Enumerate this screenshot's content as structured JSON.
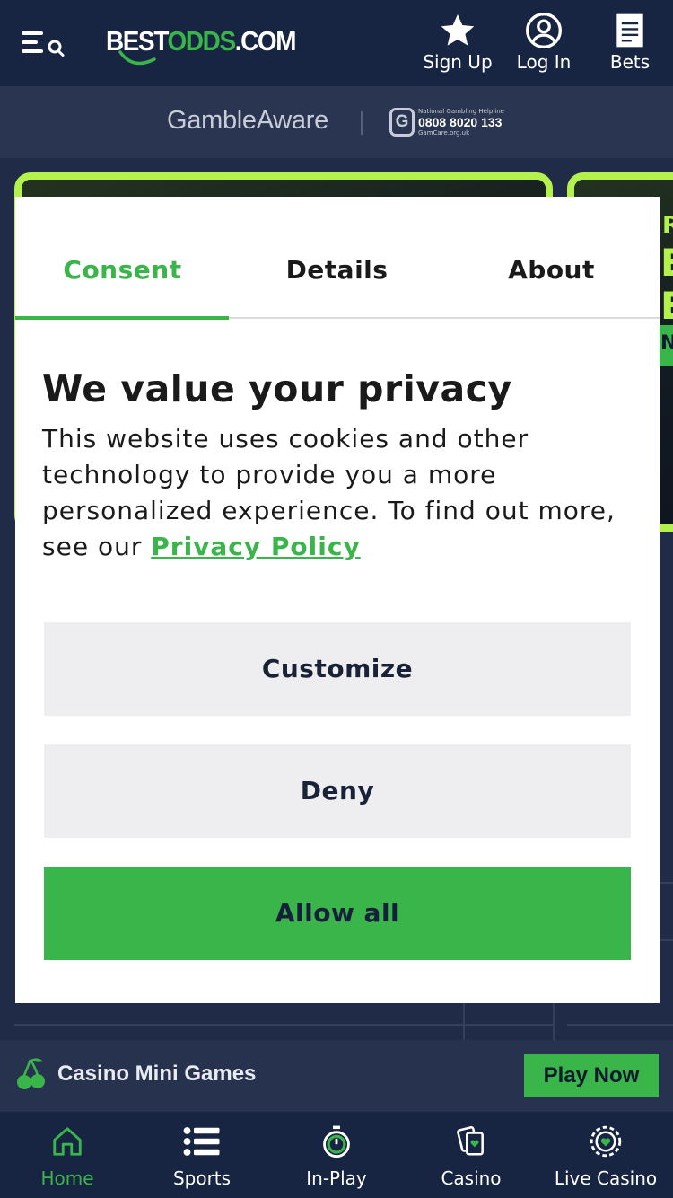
{
  "header": {
    "logo_text_a": "BEST",
    "logo_text_b": "ODDS",
    "logo_text_c": ".COM",
    "actions": [
      {
        "label": "Sign Up",
        "icon": "star-icon"
      },
      {
        "label": "Log In",
        "icon": "user-circle-icon"
      },
      {
        "label": "Bets",
        "icon": "betslip-icon"
      }
    ]
  },
  "responsible": {
    "gambleaware": "GambleAware",
    "helpline_title": "National Gambling Helpline",
    "helpline_number": "0808 8020 133",
    "helpline_site": "GamCare.org.uk"
  },
  "promo_peek": {
    "card_two_letters": [
      "RO",
      "E",
      "E",
      "N"
    ]
  },
  "mini_games": {
    "title": "Casino Mini Games",
    "button": "Play Now"
  },
  "bottom_nav": {
    "items": [
      {
        "label": "Home",
        "icon": "home-icon",
        "active": true
      },
      {
        "label": "Sports",
        "icon": "list-icon",
        "active": false
      },
      {
        "label": "In-Play",
        "icon": "stopwatch-icon",
        "active": false
      },
      {
        "label": "Casino",
        "icon": "cards-icon",
        "active": false
      },
      {
        "label": "Live Casino",
        "icon": "chip-icon",
        "active": false
      }
    ]
  },
  "consent": {
    "tabs": [
      "Consent",
      "Details",
      "About"
    ],
    "active_tab": "Consent",
    "heading": "We value your privacy",
    "body": "This website uses cookies and other technology to provide you a more personalized experience. To find out more, see our ",
    "link": "Privacy Policy",
    "buttons": {
      "customize": "Customize",
      "deny": "Deny",
      "allow": "Allow all"
    }
  },
  "colors": {
    "accent": "#3ab54a",
    "header_bg": "#172542",
    "promo_border": "#b4f14c"
  }
}
